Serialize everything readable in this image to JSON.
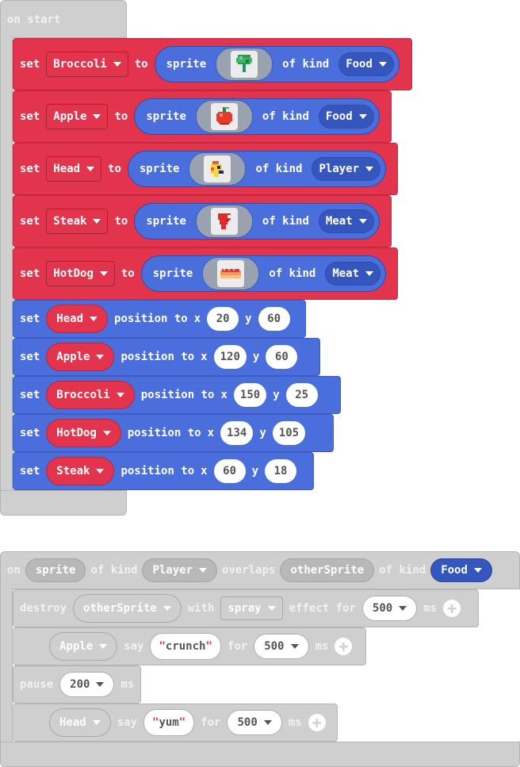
{
  "on_start": {
    "label": "on start",
    "create_blocks": [
      {
        "set": "set",
        "var": "Broccoli",
        "to": "to",
        "sprite": "sprite",
        "of_kind": "of kind",
        "kind": "Food"
      },
      {
        "set": "set",
        "var": "Apple",
        "to": "to",
        "sprite": "sprite",
        "of_kind": "of kind",
        "kind": "Food"
      },
      {
        "set": "set",
        "var": "Head",
        "to": "to",
        "sprite": "sprite",
        "of_kind": "of kind",
        "kind": "Player"
      },
      {
        "set": "set",
        "var": "Steak",
        "to": "to",
        "sprite": "sprite",
        "of_kind": "of kind",
        "kind": "Meat"
      },
      {
        "set": "set",
        "var": "HotDog",
        "to": "to",
        "sprite": "sprite",
        "of_kind": "of kind",
        "kind": "Meat"
      }
    ],
    "position_blocks": [
      {
        "set": "set",
        "var": "Head",
        "position_to": "position to",
        "x_label": "x",
        "x": "20",
        "y_label": "y",
        "y": "60"
      },
      {
        "set": "set",
        "var": "Apple",
        "position_to": "position to",
        "x_label": "x",
        "x": "120",
        "y_label": "y",
        "y": "60"
      },
      {
        "set": "set",
        "var": "Broccoli",
        "position_to": "position to",
        "x_label": "x",
        "x": "150",
        "y_label": "y",
        "y": "25"
      },
      {
        "set": "set",
        "var": "HotDog",
        "position_to": "position to",
        "x_label": "x",
        "x": "134",
        "y_label": "y",
        "y": "105"
      },
      {
        "set": "set",
        "var": "Steak",
        "position_to": "position to",
        "x_label": "x",
        "x": "60",
        "y_label": "y",
        "y": "18"
      }
    ]
  },
  "overlap_event": {
    "on": "on",
    "sprite": "sprite",
    "of_kind_1": "of kind",
    "kind_1": "Player",
    "overlaps": "overlaps",
    "other_sprite": "otherSprite",
    "of_kind_2": "of kind",
    "kind_2": "Food",
    "destroy": {
      "label": "destroy",
      "target": "otherSprite",
      "with": "with",
      "effect": "spray",
      "effect_for": "effect for",
      "ms_value": "500",
      "ms": "ms"
    },
    "say_apple": {
      "sprite": "Apple",
      "say": "say",
      "text": "crunch",
      "for": "for",
      "ms_value": "500",
      "ms": "ms"
    },
    "pause": {
      "label": "pause",
      "ms_value": "200",
      "ms": "ms"
    },
    "say_head": {
      "sprite": "Head",
      "say": "say",
      "text": "yum",
      "for": "for",
      "ms_value": "500",
      "ms": "ms"
    }
  },
  "icons": {
    "broccoli": "broccoli-sprite-icon",
    "apple": "apple-sprite-icon",
    "head": "head-sprite-icon",
    "steak": "steak-sprite-icon",
    "hotdog": "hotdog-sprite-icon",
    "add": "plus-icon",
    "dropdown": "caret-down-icon"
  },
  "colors": {
    "sprites_red": "#e3344d",
    "sprites_blue": "#4a6fdc",
    "event_gray": "#cfcfcf"
  }
}
